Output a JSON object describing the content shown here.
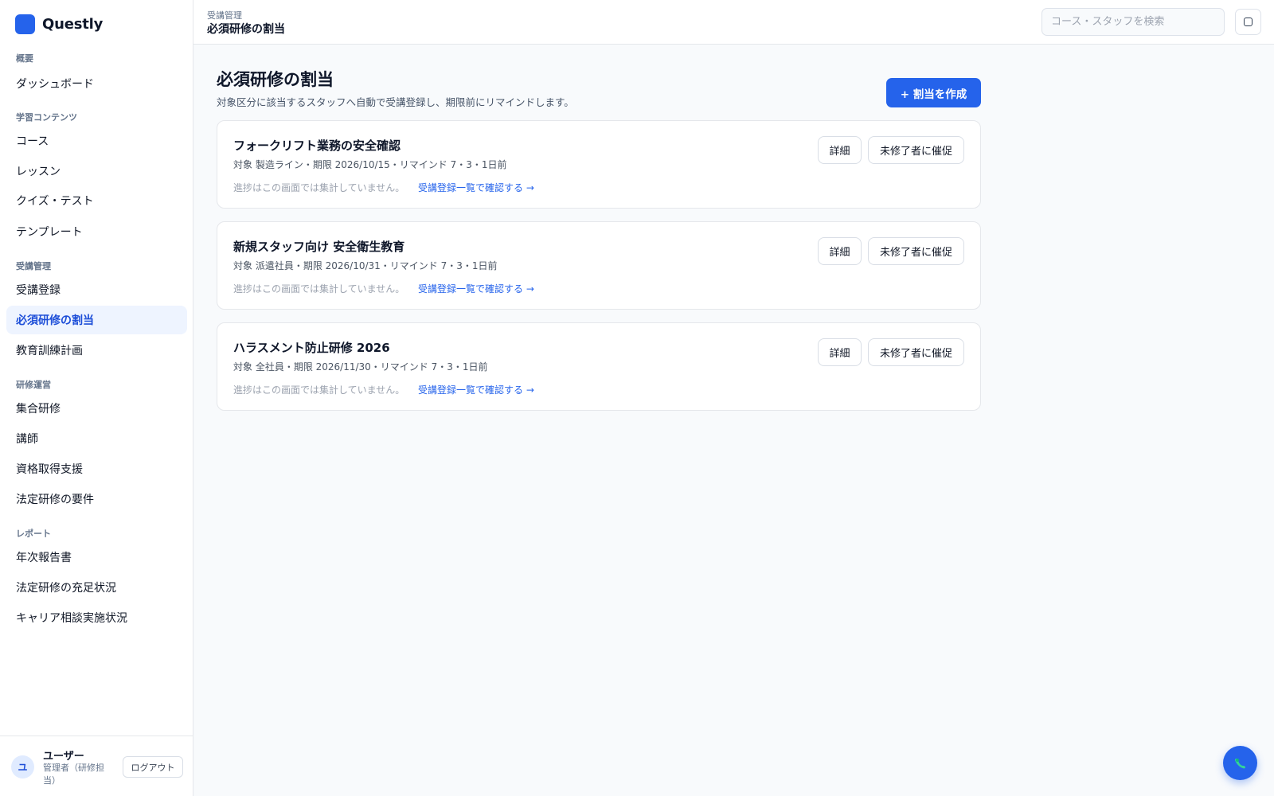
{
  "app": {
    "name": "Questly",
    "brand_color": "#2563eb"
  },
  "sidebar": {
    "sections": [
      {
        "label": "概要",
        "items": [
          {
            "label": "ダッシュボード"
          }
        ]
      },
      {
        "label": "学習コンテンツ",
        "items": [
          {
            "label": "コース"
          },
          {
            "label": "レッスン"
          },
          {
            "label": "クイズ・テスト"
          },
          {
            "label": "テンプレート"
          }
        ]
      },
      {
        "label": "受講管理",
        "items": [
          {
            "label": "受講登録"
          },
          {
            "label": "必須研修の割当",
            "active": true
          },
          {
            "label": "教育訓練計画"
          }
        ]
      },
      {
        "label": "研修運営",
        "items": [
          {
            "label": "集合研修"
          },
          {
            "label": "講師"
          },
          {
            "label": "資格取得支援"
          },
          {
            "label": "法定研修の要件"
          }
        ]
      },
      {
        "label": "レポート",
        "items": [
          {
            "label": "年次報告書"
          },
          {
            "label": "法定研修の充足状況"
          },
          {
            "label": "キャリア相談実施状況"
          }
        ]
      }
    ],
    "user": {
      "avatar": "ユ",
      "name": "ユーザー",
      "role": "管理者（研修担当）",
      "logout": "ログアウト"
    }
  },
  "header": {
    "breadcrumb": "受講管理",
    "title": "必須研修の割当",
    "search_placeholder": "コース・スタッフを検索",
    "icon": "square-icon"
  },
  "main": {
    "title": "必須研修の割当",
    "description": "対象区分に該当するスタッフへ自動で受講登録し、期限前にリマインドします。",
    "create_button": "+ 割当を作成",
    "cards": [
      {
        "title": "フォークリフト業務の安全確認",
        "meta": "対象 製造ライン・期限 2026/10/15・リマインド 7・3・1日前",
        "note": "進捗はこの画面では集計していません。",
        "link": "受講登録一覧で確認する →",
        "detail_button": "詳細",
        "remind_button": "未修了者に催促"
      },
      {
        "title": "新規スタッフ向け 安全衛生教育",
        "meta": "対象 派遣社員・期限 2026/10/31・リマインド 7・3・1日前",
        "note": "進捗はこの画面では集計していません。",
        "link": "受講登録一覧で確認する →",
        "detail_button": "詳細",
        "remind_button": "未修了者に催促"
      },
      {
        "title": "ハラスメント防止研修 2026",
        "meta": "対象 全社員・期限 2026/11/30・リマインド 7・3・1日前",
        "note": "進捗はこの画面では集計していません。",
        "link": "受講登録一覧で確認する →",
        "detail_button": "詳細",
        "remind_button": "未修了者に催促"
      }
    ]
  },
  "fab": {
    "icon": "chat-icon"
  }
}
